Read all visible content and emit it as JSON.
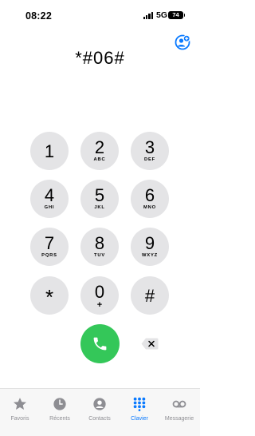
{
  "status_bar": {
    "time": "08:22",
    "network": "5G",
    "battery_level": "74"
  },
  "dialer": {
    "dialed_number": "*#06#",
    "keys": [
      {
        "digit": "1",
        "letters": ""
      },
      {
        "digit": "2",
        "letters": "ABC"
      },
      {
        "digit": "3",
        "letters": "DEF"
      },
      {
        "digit": "4",
        "letters": "GHI"
      },
      {
        "digit": "5",
        "letters": "JKL"
      },
      {
        "digit": "6",
        "letters": "MNO"
      },
      {
        "digit": "7",
        "letters": "PQRS"
      },
      {
        "digit": "8",
        "letters": "TUV"
      },
      {
        "digit": "9",
        "letters": "WXYZ"
      },
      {
        "digit": "*",
        "letters": ""
      },
      {
        "digit": "0",
        "letters": "+"
      },
      {
        "digit": "#",
        "letters": ""
      }
    ]
  },
  "tab_bar": {
    "tabs": [
      {
        "label": "Favoris",
        "icon": "star-icon",
        "active": false
      },
      {
        "label": "Récents",
        "icon": "clock-icon",
        "active": false
      },
      {
        "label": "Contacts",
        "icon": "person-icon",
        "active": false
      },
      {
        "label": "Clavier",
        "icon": "keypad-icon",
        "active": true
      },
      {
        "label": "Messagerie",
        "icon": "voicemail-icon",
        "active": false
      }
    ]
  },
  "colors": {
    "call_green": "#34c759",
    "key_gray": "#e4e4e6",
    "accent_blue": "#0a7aff",
    "inactive_gray": "#8e8e93"
  }
}
